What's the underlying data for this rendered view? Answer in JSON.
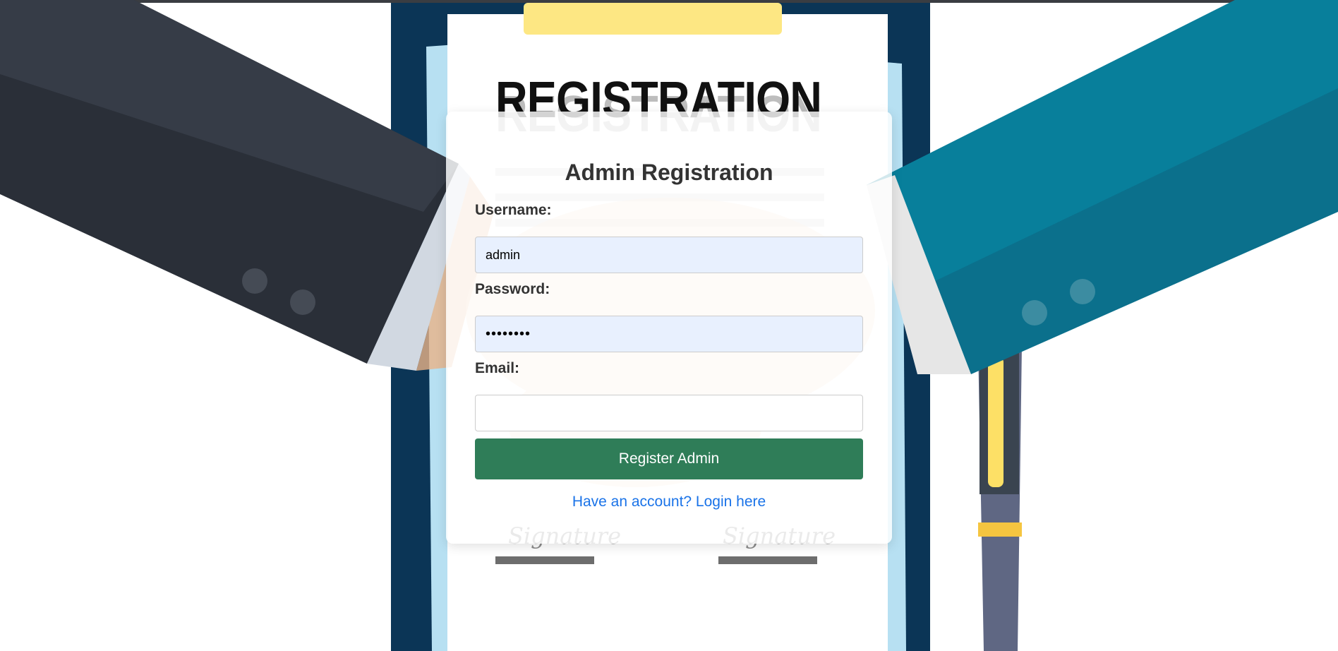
{
  "background": {
    "clipboard_title": "REGISTRATION",
    "signature_label": "Signature"
  },
  "form": {
    "title": "Admin Registration",
    "username": {
      "label": "Username:",
      "value": "admin"
    },
    "password": {
      "label": "Password:",
      "value": "••••••••"
    },
    "email": {
      "label": "Email:",
      "value": ""
    },
    "submit_label": "Register Admin",
    "login_link": "Have an account? Login here"
  },
  "colors": {
    "button_green": "#2f7d58",
    "link_blue": "#1a73e8",
    "autofill_blue": "#e8f0fe",
    "clipboard_navy": "#0b3556",
    "left_sleeve": "#343a44",
    "right_sleeve": "#087f9b"
  }
}
